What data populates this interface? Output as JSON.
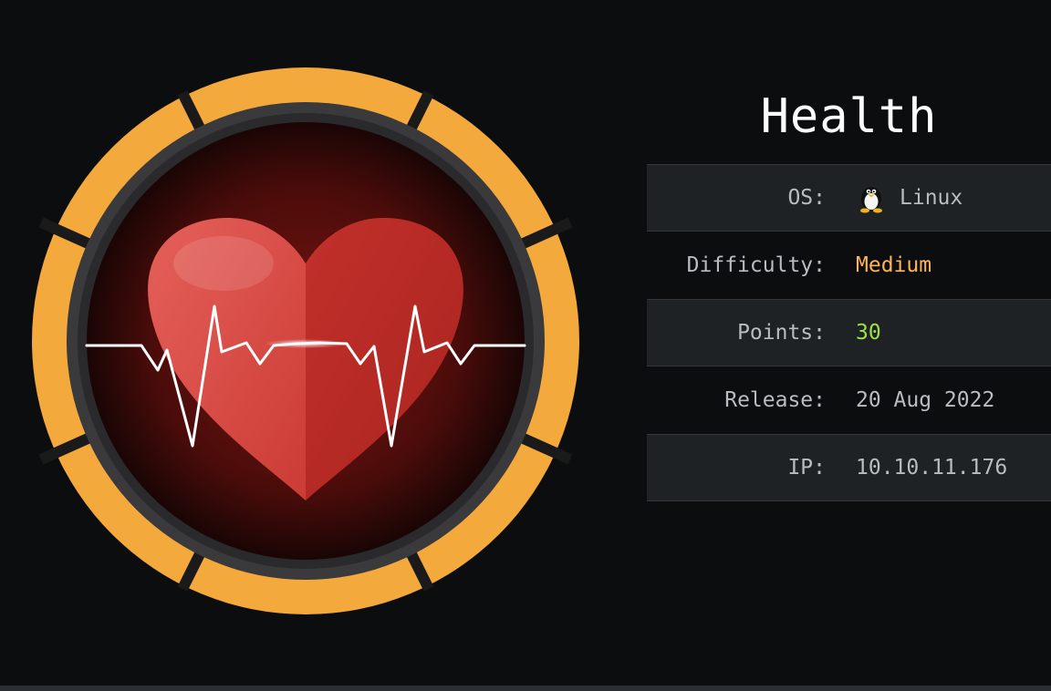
{
  "machine": {
    "name": "Health",
    "fields": [
      {
        "label": "OS:",
        "value": "Linux",
        "icon": "tux-penguin-icon"
      },
      {
        "label": "Difficulty:",
        "value": "Medium"
      },
      {
        "label": "Points:",
        "value": "30"
      },
      {
        "label": "Release:",
        "value": "20 Aug 2022"
      },
      {
        "label": "IP:",
        "value": "10.10.11.176"
      }
    ]
  },
  "colors": {
    "background": "#0c0d0f",
    "row_shade": "#1f2225",
    "ring_orange": "#f4a93c",
    "heart_red": "#d6423c",
    "difficulty_medium": "#ffb352",
    "points_green": "#9fe042",
    "title": "#ffffff"
  },
  "badge": {
    "icon": "heart-pulse-badge-icon"
  }
}
